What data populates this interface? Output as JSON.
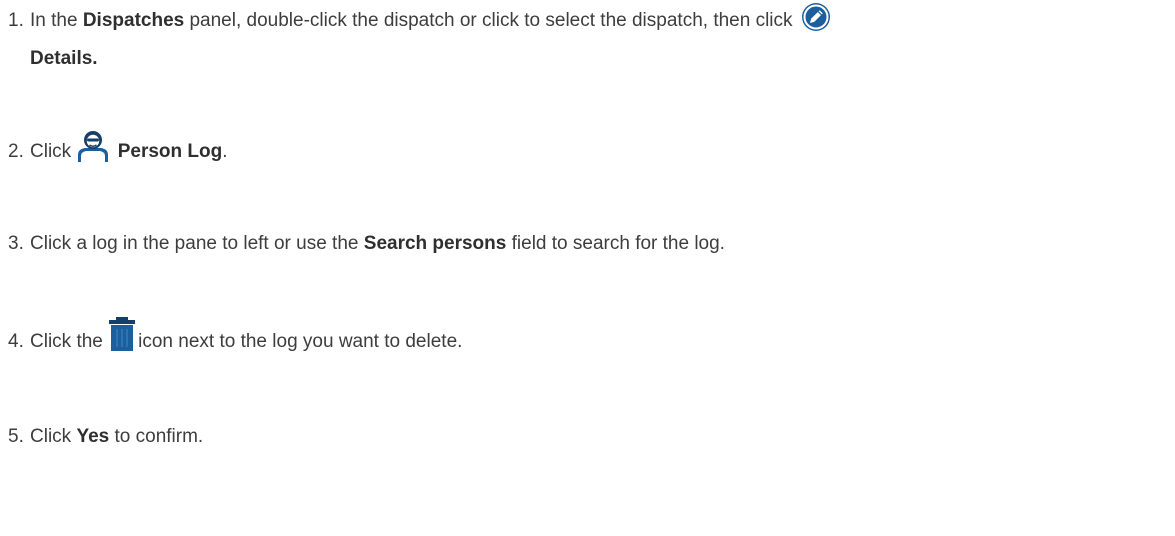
{
  "steps": [
    {
      "number": "1.",
      "pre": "In the ",
      "bold1": "Dispatches",
      "mid": " panel, double-click the dispatch or click to select the dispatch, then click ",
      "icon": "pencil-edit-icon",
      "bold2": "Details."
    },
    {
      "number": "2.",
      "pre": "Click ",
      "icon": "person-log-icon",
      "bold1": "Person Log",
      "post": "."
    },
    {
      "number": "3.",
      "pre": "Click a log in the pane to left or use the ",
      "bold1": "Search persons",
      "post": " field to search for the log."
    },
    {
      "number": "4.",
      "pre": "Click the ",
      "icon": "trash-delete-icon",
      "post": "icon next to the log you want to delete."
    },
    {
      "number": "5.",
      "pre": "Click ",
      "bold1": "Yes",
      "post": " to confirm."
    }
  ],
  "colors": {
    "text": "#3d3d3d",
    "icon_blue": "#1c5f9c",
    "icon_dark": "#163e66"
  }
}
